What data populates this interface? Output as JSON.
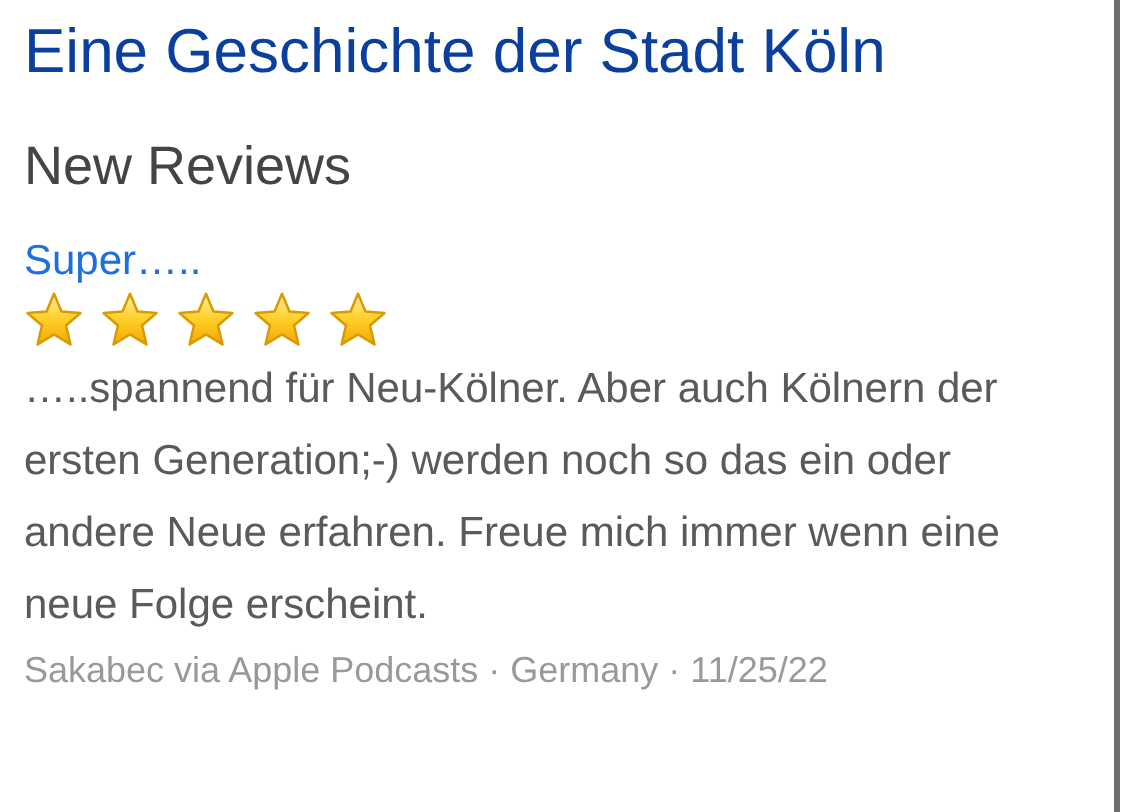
{
  "page_title": "Eine Geschichte der Stadt Köln",
  "section_title": "New Reviews",
  "reviews": [
    {
      "title": "Super…..",
      "stars": 5,
      "body": "…..spannend für Neu-Kölner. Aber auch Kölnern der ersten Generation;-) werden noch so das ein oder andere Neue erfahren. Freue mich immer wenn eine neue Folge erscheint.",
      "meta": "Sakabec via Apple Podcasts · Germany · 11/25/22"
    }
  ]
}
